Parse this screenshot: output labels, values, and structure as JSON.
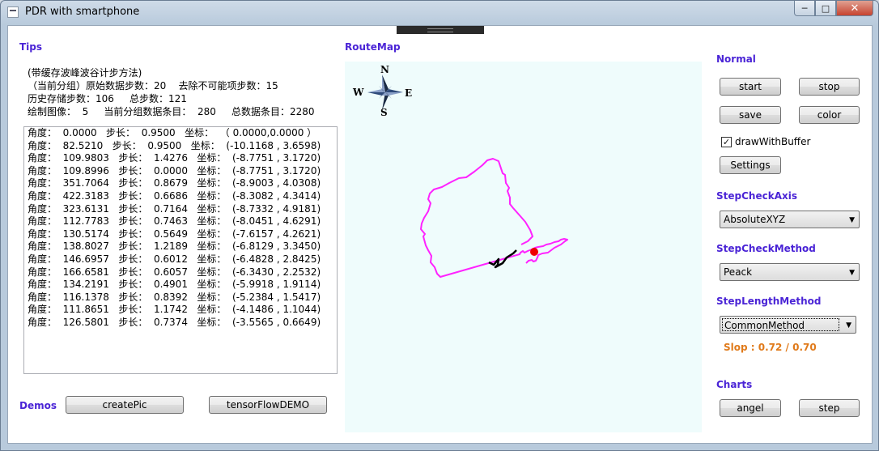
{
  "window": {
    "title": "PDR  with smartphone",
    "close_icon": "close-icon",
    "minimize_icon": "minimize-icon",
    "maximize_icon": "maximize-icon"
  },
  "tips": {
    "heading": "Tips",
    "lines": [
      "(带缓存波峰波谷计步方法)",
      "（当前分组）原始数据步数：20    去除不可能项步数：15",
      "历史存储步数：106     总步数：121",
      "绘制图像：  5     当前分组数据条目：  280     总数据条目：2280"
    ],
    "list": [
      "角度：  0.0000   步长：  0.9500   坐标：  （ 0.0000,0.0000 ）",
      "角度：  82.5210   步长：  0.9500   坐标：  (-10.1168 , 3.6598)",
      "角度：  109.9803   步长：  1.4276   坐标：  (-8.7751 , 3.1720)",
      "角度：  109.8996   步长：  0.0000   坐标：  (-8.7751 , 3.1720)",
      "角度：  351.7064   步长：  0.8679   坐标：  (-8.9003 , 4.0308)",
      "角度：  422.3183   步长：  0.6686   坐标：  (-8.3082 , 4.3414)",
      "角度：  323.6131   步长：  0.7164   坐标：  (-8.7332 , 4.9181)",
      "角度：  112.7783   步长：  0.7463   坐标：  (-8.0451 , 4.6291)",
      "角度：  130.5174   步长：  0.5649   坐标：  (-7.6157 , 4.2621)",
      "角度：  138.8027   步长：  1.2189   坐标：  (-6.8129 , 3.3450)",
      "角度：  146.6957   步长：  0.6012   坐标：  (-6.4828 , 2.8425)",
      "角度：  166.6581   步长：  0.6057   坐标：  (-6.3430 , 2.2532)",
      "角度：  134.2191   步长：  0.4901   坐标：  (-5.9918 , 1.9114)",
      "角度：  116.1378   步长：  0.8392   坐标：  (-5.2384 , 1.5417)",
      "角度：  111.8651   步长：  1.1742   坐标：  (-4.1486 , 1.1044)",
      "角度：  126.5801   步长：  0.7374   坐标：  (-3.5565 , 0.6649)"
    ]
  },
  "demos": {
    "heading": "Demos",
    "create_pic": "createPic",
    "tensorflow": "tensorFlowDEMO"
  },
  "routemap": {
    "heading": "RouteMap",
    "compass": {
      "n": "N",
      "s": "S",
      "e": "E",
      "w": "W",
      "icon": "compass-rose-icon"
    },
    "colors": {
      "background": "#effcfc",
      "route": "#ff22ff",
      "current_path": "#000000",
      "position_dot": "#ee0000"
    }
  },
  "normal": {
    "heading": "Normal",
    "start": "start",
    "stop": "stop",
    "save": "save",
    "color": "color",
    "draw_with_buffer_label": "drawWithBuffer",
    "draw_with_buffer_checked": true,
    "settings": "Settings"
  },
  "step_check_axis": {
    "heading": "StepCheckAxis",
    "value": "AbsoluteXYZ"
  },
  "step_check_method": {
    "heading": "StepCheckMethod",
    "value": "Peack"
  },
  "step_length_method": {
    "heading": "StepLengthMethod",
    "value": "CommonMethod"
  },
  "slope": "Slop :  0.72 / 0.70",
  "charts": {
    "heading": "Charts",
    "angel": "angel",
    "step": "step"
  },
  "accent_color": "#4a24d6",
  "slope_color": "#e07a1a"
}
